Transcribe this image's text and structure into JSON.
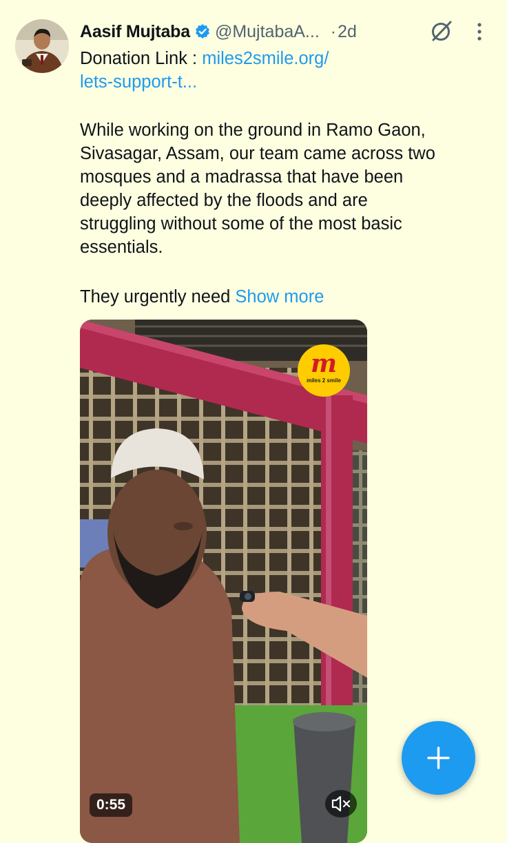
{
  "tweet": {
    "author_name": "Aasif Mujtaba",
    "handle": "@MujtabaA...",
    "separator": "·",
    "time": "2d",
    "line_1_prefix": "Donation Link : ",
    "line_1_link": "miles2smile.org/",
    "line_2_link": "lets-support-t...",
    "body_lines": [
      "While working on the ground in Ramo Gaon,",
      "Sivasagar, Assam, our team came across two",
      "mosques and a madrassa that have been",
      "deeply affected by the floods and are",
      "struggling without some of the most basic",
      "essentials."
    ],
    "last_line_text": "They urgently need ",
    "show_more": "Show more"
  },
  "media": {
    "duration": "0:55",
    "logo_mark": "m",
    "logo_text": "miles 2 smile"
  },
  "icons": {
    "verified": "verified-badge-icon",
    "grok": "grok-icon",
    "more": "more-vertical-icon",
    "mute": "volume-muted-icon",
    "compose": "plus-icon"
  },
  "colors": {
    "background": "#fefee0",
    "link": "#1d9bf0",
    "secondary_text": "#536471",
    "fab": "#1d9bf0",
    "logo_badge": "#ffcc00"
  }
}
